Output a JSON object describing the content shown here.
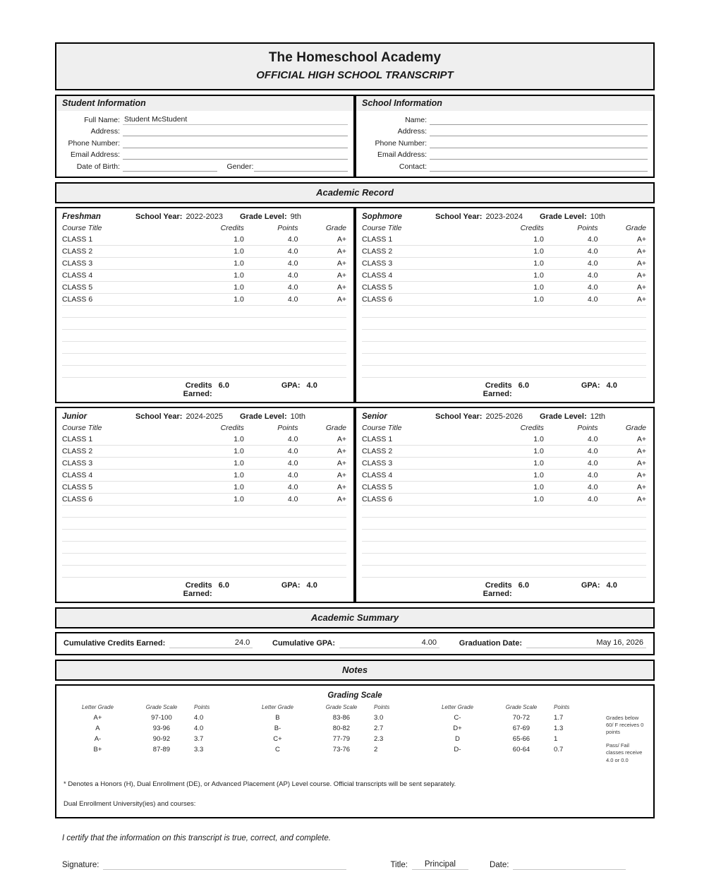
{
  "header": {
    "school_name": "The Homeschool Academy",
    "doc_type": "OFFICIAL HIGH SCHOOL TRANSCRIPT"
  },
  "student_information": {
    "section_title": "Student Information",
    "full_name_label": "Full Name:",
    "full_name_value": "Student McStudent",
    "address_label": "Address:",
    "address_value": "",
    "phone_label": "Phone Number:",
    "phone_value": "",
    "email_label": "Email Address:",
    "email_value": "",
    "dob_label": "Date of Birth:",
    "dob_value": "",
    "gender_label": "Gender:",
    "gender_value": ""
  },
  "school_information": {
    "section_title": "School Information",
    "name_label": "Name:",
    "name_value": "",
    "address_label": "Address:",
    "address_value": "",
    "phone_label": "Phone Number:",
    "phone_value": "",
    "email_label": "Email Address:",
    "email_value": "",
    "contact_label": "Contact:",
    "contact_value": ""
  },
  "academic_record": {
    "band_title": "Academic Record",
    "column_headers": {
      "course_title": "Course Title",
      "credits": "Credits",
      "points": "Points",
      "grade": "Grade"
    },
    "labels": {
      "school_year": "School Year:",
      "grade_level": "Grade Level:",
      "credits_earned": "Credits Earned:",
      "gpa": "GPA:"
    },
    "terms": [
      {
        "name": "Freshman",
        "school_year": "2022-2023",
        "grade_level": "9th",
        "courses": [
          {
            "title": "CLASS 1",
            "credits": "1.0",
            "points": "4.0",
            "grade": "A+"
          },
          {
            "title": "CLASS 2",
            "credits": "1.0",
            "points": "4.0",
            "grade": "A+"
          },
          {
            "title": "CLASS 3",
            "credits": "1.0",
            "points": "4.0",
            "grade": "A+"
          },
          {
            "title": "CLASS 4",
            "credits": "1.0",
            "points": "4.0",
            "grade": "A+"
          },
          {
            "title": "CLASS 5",
            "credits": "1.0",
            "points": "4.0",
            "grade": "A+"
          },
          {
            "title": "CLASS 6",
            "credits": "1.0",
            "points": "4.0",
            "grade": "A+"
          }
        ],
        "empty_rows": 6,
        "credits_earned": "6.0",
        "gpa": "4.0"
      },
      {
        "name": "Sophmore",
        "school_year": "2023-2024",
        "grade_level": "10th",
        "courses": [
          {
            "title": "CLASS 1",
            "credits": "1.0",
            "points": "4.0",
            "grade": "A+"
          },
          {
            "title": "CLASS 2",
            "credits": "1.0",
            "points": "4.0",
            "grade": "A+"
          },
          {
            "title": "CLASS 3",
            "credits": "1.0",
            "points": "4.0",
            "grade": "A+"
          },
          {
            "title": "CLASS 4",
            "credits": "1.0",
            "points": "4.0",
            "grade": "A+"
          },
          {
            "title": "CLASS 5",
            "credits": "1.0",
            "points": "4.0",
            "grade": "A+"
          },
          {
            "title": "CLASS 6",
            "credits": "1.0",
            "points": "4.0",
            "grade": "A+"
          }
        ],
        "empty_rows": 6,
        "credits_earned": "6.0",
        "gpa": "4.0"
      },
      {
        "name": "Junior",
        "school_year": "2024-2025",
        "grade_level": "10th",
        "courses": [
          {
            "title": "CLASS 1",
            "credits": "1.0",
            "points": "4.0",
            "grade": "A+"
          },
          {
            "title": "CLASS 2",
            "credits": "1.0",
            "points": "4.0",
            "grade": "A+"
          },
          {
            "title": "CLASS 3",
            "credits": "1.0",
            "points": "4.0",
            "grade": "A+"
          },
          {
            "title": "CLASS 4",
            "credits": "1.0",
            "points": "4.0",
            "grade": "A+"
          },
          {
            "title": "CLASS 5",
            "credits": "1.0",
            "points": "4.0",
            "grade": "A+"
          },
          {
            "title": "CLASS 6",
            "credits": "1.0",
            "points": "4.0",
            "grade": "A+"
          }
        ],
        "empty_rows": 6,
        "credits_earned": "6.0",
        "gpa": "4.0"
      },
      {
        "name": "Senior",
        "school_year": "2025-2026",
        "grade_level": "12th",
        "courses": [
          {
            "title": "CLASS 1",
            "credits": "1.0",
            "points": "4.0",
            "grade": "A+"
          },
          {
            "title": "CLASS 2",
            "credits": "1.0",
            "points": "4.0",
            "grade": "A+"
          },
          {
            "title": "CLASS 3",
            "credits": "1.0",
            "points": "4.0",
            "grade": "A+"
          },
          {
            "title": "CLASS 4",
            "credits": "1.0",
            "points": "4.0",
            "grade": "A+"
          },
          {
            "title": "CLASS 5",
            "credits": "1.0",
            "points": "4.0",
            "grade": "A+"
          },
          {
            "title": "CLASS 6",
            "credits": "1.0",
            "points": "4.0",
            "grade": "A+"
          }
        ],
        "empty_rows": 6,
        "credits_earned": "6.0",
        "gpa": "4.0"
      }
    ]
  },
  "academic_summary": {
    "band_title": "Academic Summary",
    "cumulative_credits_label": "Cumulative Credits Earned:",
    "cumulative_credits_value": "24.0",
    "cumulative_gpa_label": "Cumulative GPA:",
    "cumulative_gpa_value": "4.00",
    "graduation_date_label": "Graduation Date:",
    "graduation_date_value": "May 16, 2026"
  },
  "notes": {
    "band_title": "Notes",
    "grading_scale_title": "Grading Scale",
    "grading_headers": {
      "letter_grade": "Letter Grade",
      "grade_scale": "Grade Scale",
      "points": "Points"
    },
    "grading_columns": [
      [
        {
          "letter": "A+",
          "scale": "97-100",
          "points": "4.0"
        },
        {
          "letter": "A",
          "scale": "93-96",
          "points": "4.0"
        },
        {
          "letter": "A-",
          "scale": "90-92",
          "points": "3.7"
        },
        {
          "letter": "B+",
          "scale": "87-89",
          "points": "3.3"
        }
      ],
      [
        {
          "letter": "B",
          "scale": "83-86",
          "points": "3.0"
        },
        {
          "letter": "B-",
          "scale": "80-82",
          "points": "2.7"
        },
        {
          "letter": "C+",
          "scale": "77-79",
          "points": "2.3"
        },
        {
          "letter": "C",
          "scale": "73-76",
          "points": "2"
        }
      ],
      [
        {
          "letter": "C-",
          "scale": "70-72",
          "points": "1.7"
        },
        {
          "letter": "D+",
          "scale": "67-69",
          "points": "1.3"
        },
        {
          "letter": "D",
          "scale": "65-66",
          "points": "1"
        },
        {
          "letter": "D-",
          "scale": "60-64",
          "points": "0.7"
        }
      ]
    ],
    "side_note_1": "Grades below 60/ F receives 0 points",
    "side_note_2": "Pass/ Fail classes receive 4.0 or 0.0",
    "footnote_asterisk": "* Denotes a Honors (H), Dual Enrollment (DE), or Advanced Placement (AP) Level course. Official transcripts will be sent separately.",
    "footnote_dual_enrollment": "Dual Enrollment University(ies) and courses:"
  },
  "footer": {
    "certification": "I certify that the information on this transcript is true, correct, and complete.",
    "signature_label": "Signature:",
    "signature_value": "",
    "title_label": "Title:",
    "title_value": "Principal",
    "date_label": "Date:",
    "date_value": ""
  }
}
